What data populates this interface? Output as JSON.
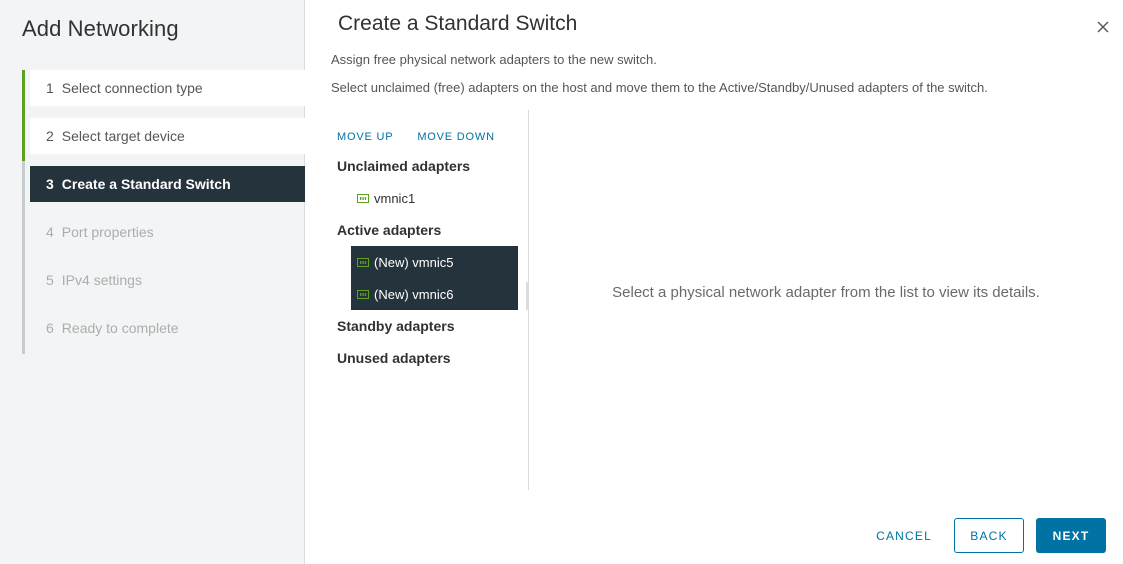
{
  "wizard": {
    "title": "Add Networking",
    "steps": [
      {
        "num": "1",
        "label": "Select connection type",
        "state": "done"
      },
      {
        "num": "2",
        "label": "Select target device",
        "state": "done"
      },
      {
        "num": "3",
        "label": "Create a Standard Switch",
        "state": "active"
      },
      {
        "num": "4",
        "label": "Port properties",
        "state": "todo"
      },
      {
        "num": "5",
        "label": "IPv4 settings",
        "state": "todo"
      },
      {
        "num": "6",
        "label": "Ready to complete",
        "state": "todo"
      }
    ]
  },
  "dialog": {
    "title": "Create a Standard Switch",
    "subtitle": "Assign free physical network adapters to the new switch.",
    "instructions": "Select unclaimed (free) adapters on the host and move them to the Active/Standby/Unused adapters of the switch."
  },
  "adapters": {
    "move_up": "MOVE UP",
    "move_down": "MOVE DOWN",
    "unclaimed_label": "Unclaimed adapters",
    "unclaimed": [
      "vmnic1"
    ],
    "active_label": "Active adapters",
    "active": [
      "(New) vmnic5",
      "(New) vmnic6"
    ],
    "standby_label": "Standby adapters",
    "unused_label": "Unused adapters"
  },
  "detail": {
    "placeholder": "Select a physical network adapter from the list to view its details."
  },
  "footer": {
    "cancel": "CANCEL",
    "back": "BACK",
    "next": "NEXT"
  },
  "colors": {
    "accent": "#0072a3",
    "active_step_bg": "#25333d",
    "progress_green": "#5aa220",
    "nic_icon": "#5aa220"
  },
  "icons": {
    "close": "close-icon",
    "nic": "network-adapter-icon"
  }
}
